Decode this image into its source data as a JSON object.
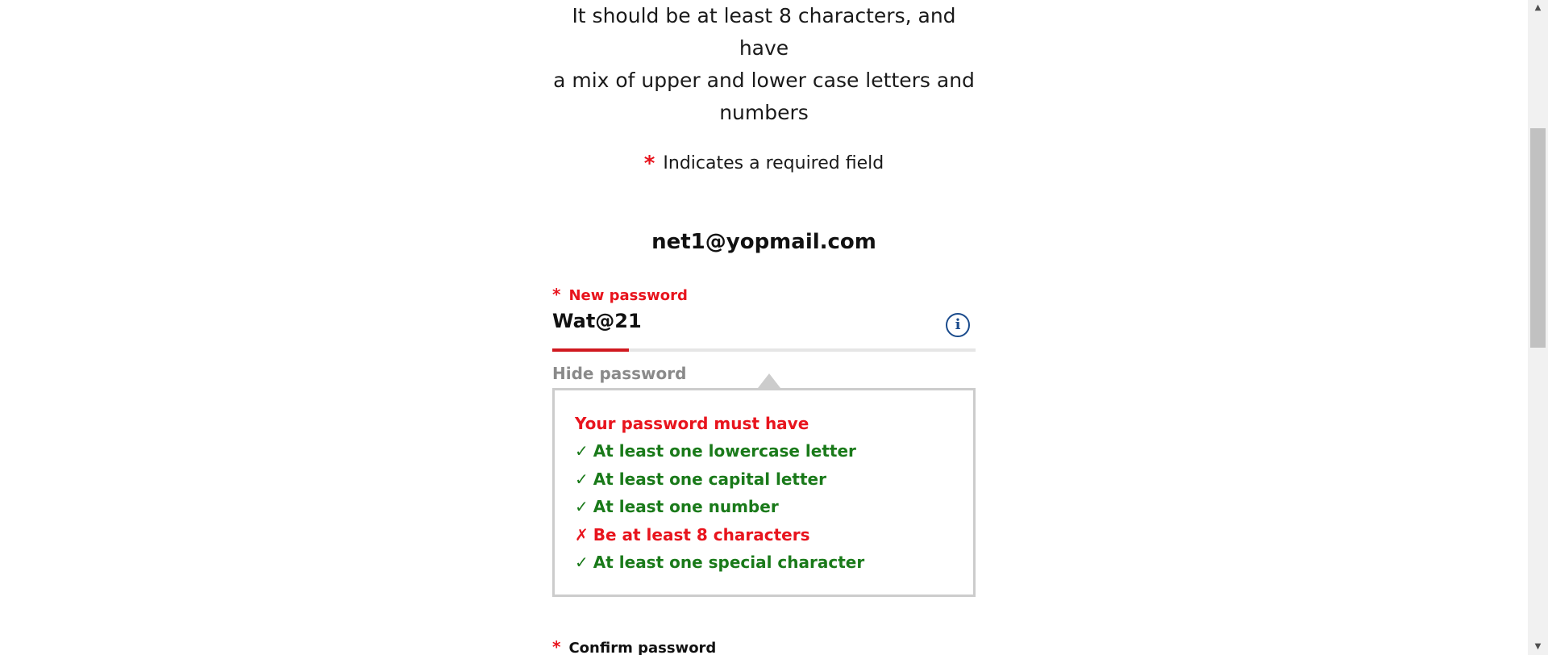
{
  "intro": {
    "line1": "It should be at least 8 characters, and have",
    "line2": "a mix of upper and lower case letters and",
    "line3": "numbers"
  },
  "required_note": {
    "star": "*",
    "text": "Indicates a required field"
  },
  "account": {
    "email": "net1@yopmail.com"
  },
  "new_password": {
    "star": "*",
    "label": "New password",
    "value": "Wat@21",
    "info_icon": "i",
    "strength_fraction": 0.18,
    "strength_color": "#d0191f",
    "hide_label": "Hide password"
  },
  "rules": {
    "title": "Your password must have",
    "items": [
      {
        "mark": "✓",
        "text": "At least one lowercase letter",
        "status": "ok"
      },
      {
        "mark": "✓",
        "text": "At least one capital letter",
        "status": "ok"
      },
      {
        "mark": "✓",
        "text": "At least one number",
        "status": "ok"
      },
      {
        "mark": "✗",
        "text": "Be at least 8 characters",
        "status": "fail"
      },
      {
        "mark": "✓",
        "text": "At least one special character",
        "status": "ok"
      }
    ]
  },
  "confirm_password": {
    "star": "*",
    "label": "Confirm password"
  },
  "colors": {
    "required_red": "#e8141d",
    "success_green": "#1a7a1a",
    "info_blue": "#1a4b8c"
  },
  "scrollbar": {
    "up_arrow": "▲",
    "down_arrow": "▼"
  }
}
